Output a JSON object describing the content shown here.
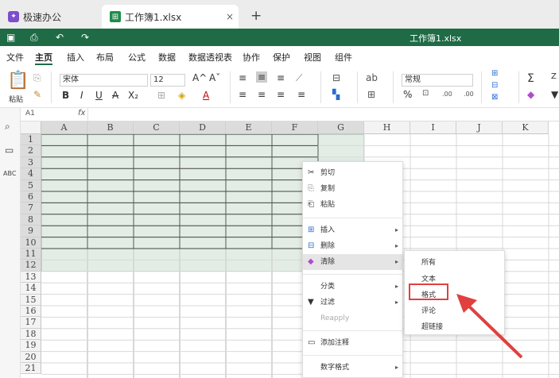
{
  "tabs": {
    "home_label": "极速办公",
    "active_label": "工作簿1.xlsx",
    "close_icon": "×",
    "new_tab_icon": "+"
  },
  "titlebar": {
    "doc_title": "工作簿1.xlsx",
    "color": "#1e6b46"
  },
  "menu": {
    "items": [
      "文件",
      "主页",
      "插入",
      "布局",
      "公式",
      "数据",
      "数据透视表",
      "协作",
      "保护",
      "视图",
      "组件"
    ],
    "active": "主页"
  },
  "toolbar": {
    "paste_label": "粘贴",
    "font_name": "宋体",
    "font_size": "12",
    "number_format": "常规",
    "bold": "B",
    "italic": "I",
    "underline": "U",
    "strike": "A",
    "subscript": "X₂",
    "grow_font": "A^",
    "shrink_font": "Aˇ",
    "font_color": "A",
    "percent": "%",
    "sum": "Σ"
  },
  "formula_bar": {
    "cell_ref": "A1",
    "fx": "fx"
  },
  "grid": {
    "columns": [
      "A",
      "B",
      "C",
      "D",
      "E",
      "F",
      "G",
      "H",
      "I",
      "J",
      "K"
    ],
    "rows": [
      "1",
      "2",
      "3",
      "4",
      "5",
      "6",
      "7",
      "8",
      "9",
      "10",
      "11",
      "12",
      "13",
      "14",
      "15",
      "16",
      "17",
      "18",
      "19",
      "20",
      "21"
    ],
    "selection": "A1:G12",
    "selection_color": "#e3ede6"
  },
  "context_menu": {
    "items": [
      {
        "label": "剪切",
        "icon": "cut-icon"
      },
      {
        "label": "复制",
        "icon": "copy-icon"
      },
      {
        "label": "粘贴",
        "icon": "paste-icon"
      },
      {
        "label": "插入",
        "icon": "insert-icon"
      },
      {
        "label": "删除",
        "icon": "delete-icon"
      },
      {
        "label": "清除",
        "icon": "eraser-icon"
      },
      {
        "label": "分类",
        "icon": ""
      },
      {
        "label": "过滤",
        "icon": "filter-icon"
      },
      {
        "label": "Reapply",
        "icon": ""
      },
      {
        "label": "添加注释",
        "icon": "comment-icon"
      },
      {
        "label": "数字格式",
        "icon": ""
      }
    ]
  },
  "submenu": {
    "items": [
      "所有",
      "文本",
      "格式",
      "评论",
      "超链接"
    ],
    "highlighted": "格式",
    "highlight_color": "#e04040"
  }
}
